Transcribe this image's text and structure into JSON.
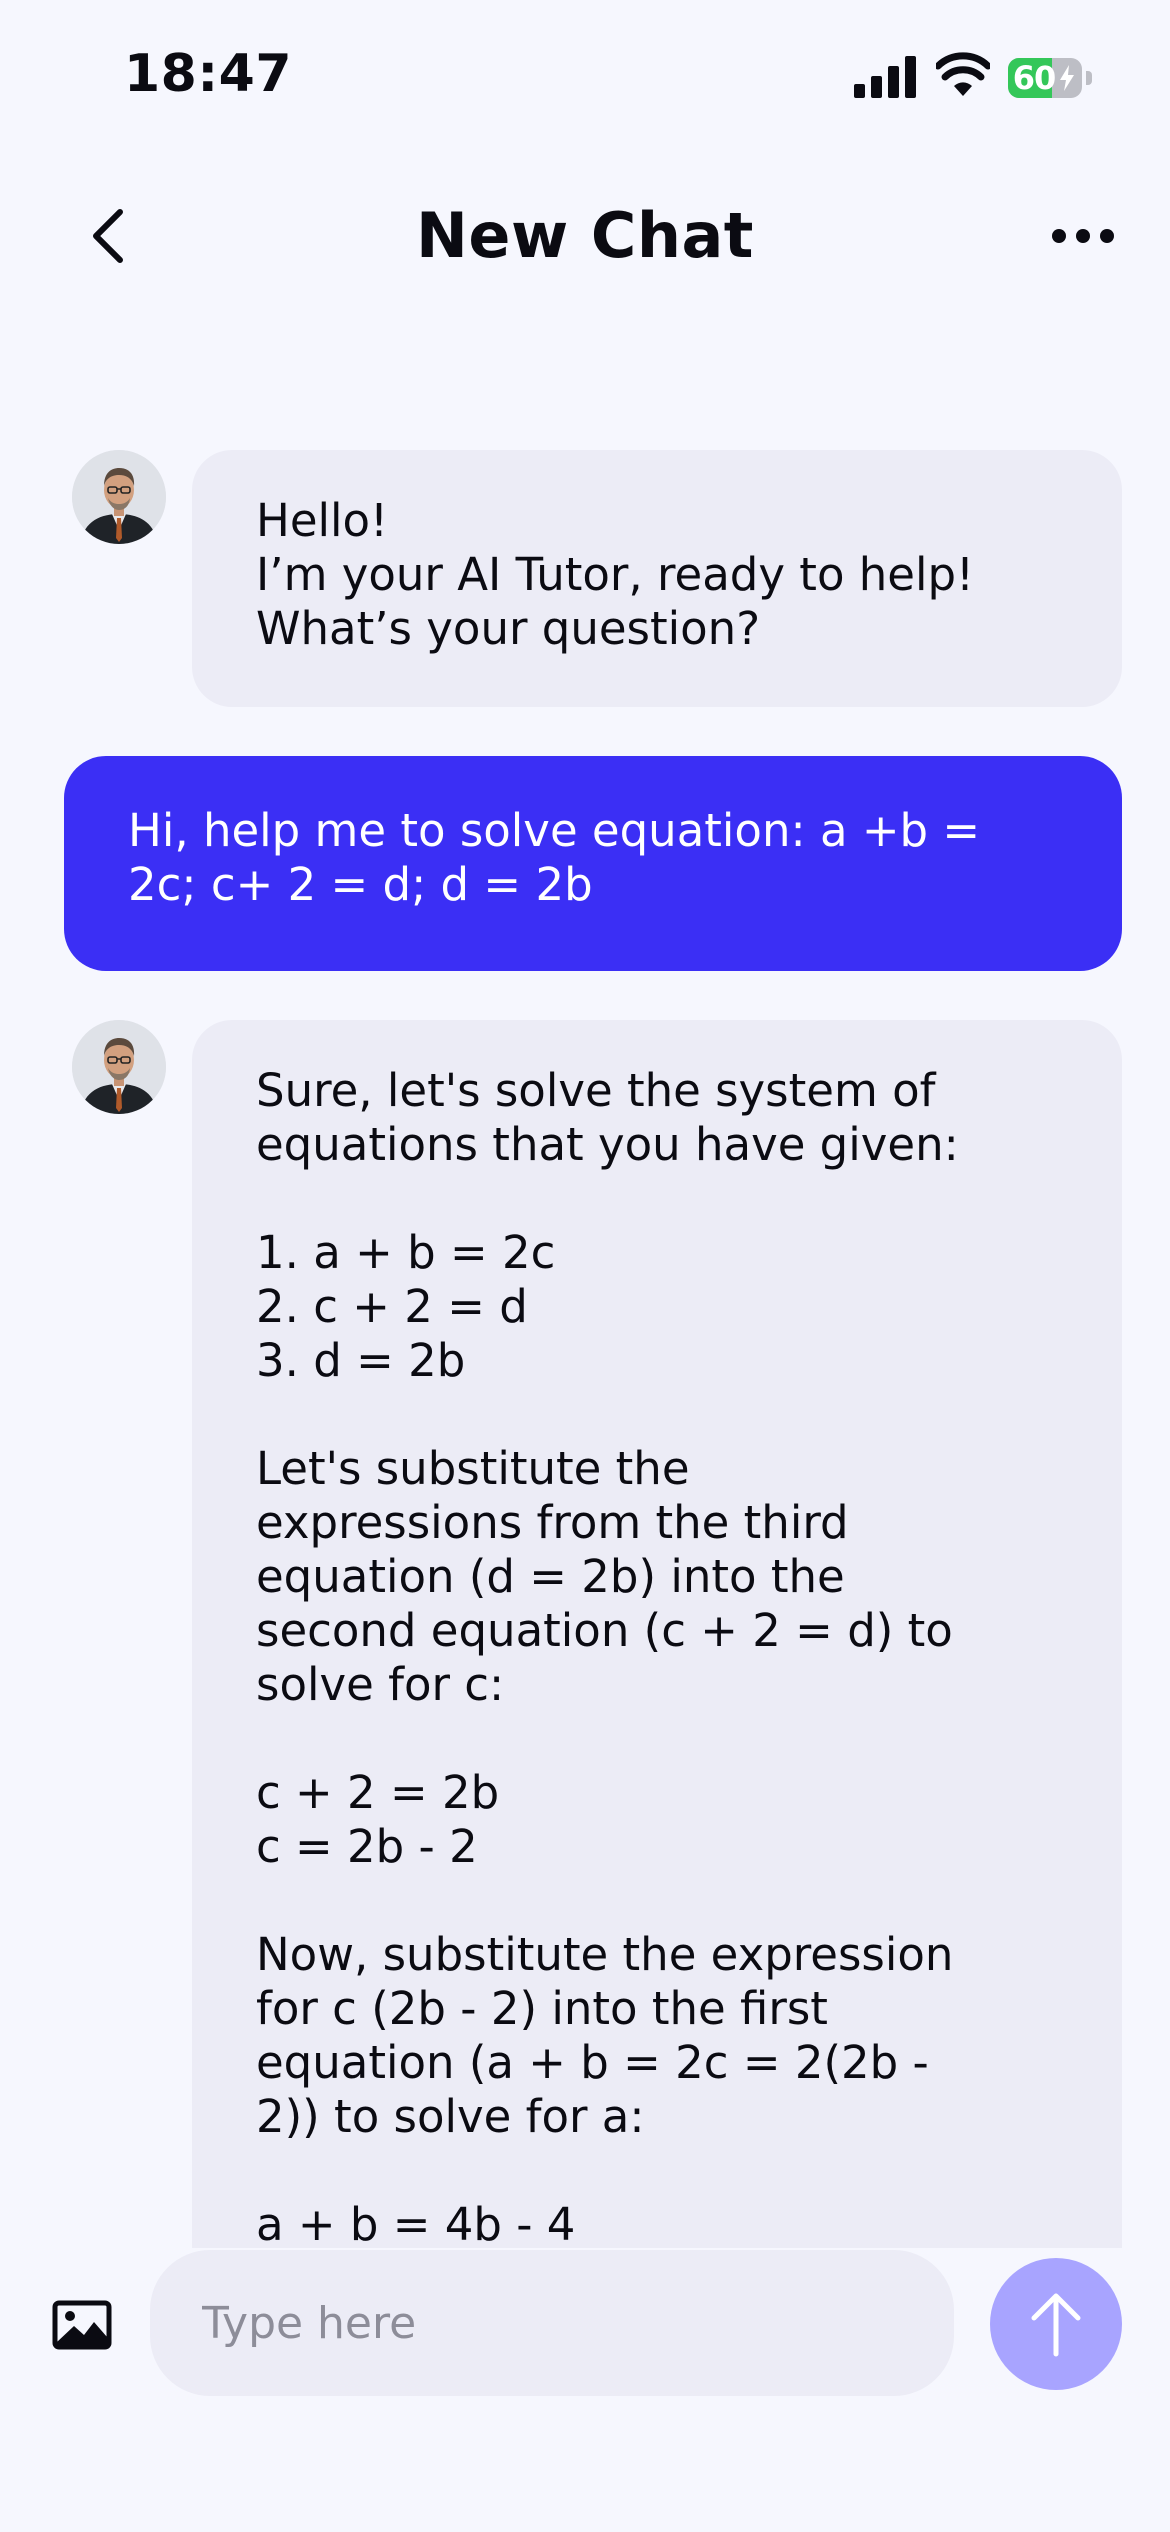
{
  "status_bar": {
    "time": "18:47",
    "battery_percent": "60",
    "battery_level": 0.6,
    "charging": true
  },
  "header": {
    "title": "New Chat",
    "back_icon": "chevron-left-icon",
    "more_icon": "ellipsis-icon"
  },
  "messages": [
    {
      "sender": "bot",
      "text": "Hello!\nI’m your AI Tutor, ready to help!\nWhat’s your question?"
    },
    {
      "sender": "user",
      "text": "Hi, help me to solve equation: a +b =\n2c; c+ 2 = d; d = 2b"
    },
    {
      "sender": "bot",
      "text": "Sure, let's solve the system of\nequations that you have given:\n\n1. a + b = 2c\n2. c + 2 = d\n3. d = 2b\n\nLet's substitute the\nexpressions from the third\nequation (d = 2b) into the\nsecond equation (c + 2 = d) to\nsolve for c:\n\nc + 2 = 2b\nc = 2b - 2\n\nNow, substitute the expression\nfor c (2b - 2) into the first\nequation (a + b = 2c = 2(2b -\n2)) to solve for a:\n\na + b = 4b - 4"
    }
  ],
  "composer": {
    "placeholder": "Type here",
    "value": "",
    "image_icon": "image-icon",
    "send_icon": "arrow-up-icon"
  },
  "colors": {
    "background": "#f6f7fe",
    "bot_bubble": "#ececf6",
    "user_bubble": "#3b2ff5",
    "send_button": "#a8a4ff",
    "battery": "#34c759"
  }
}
